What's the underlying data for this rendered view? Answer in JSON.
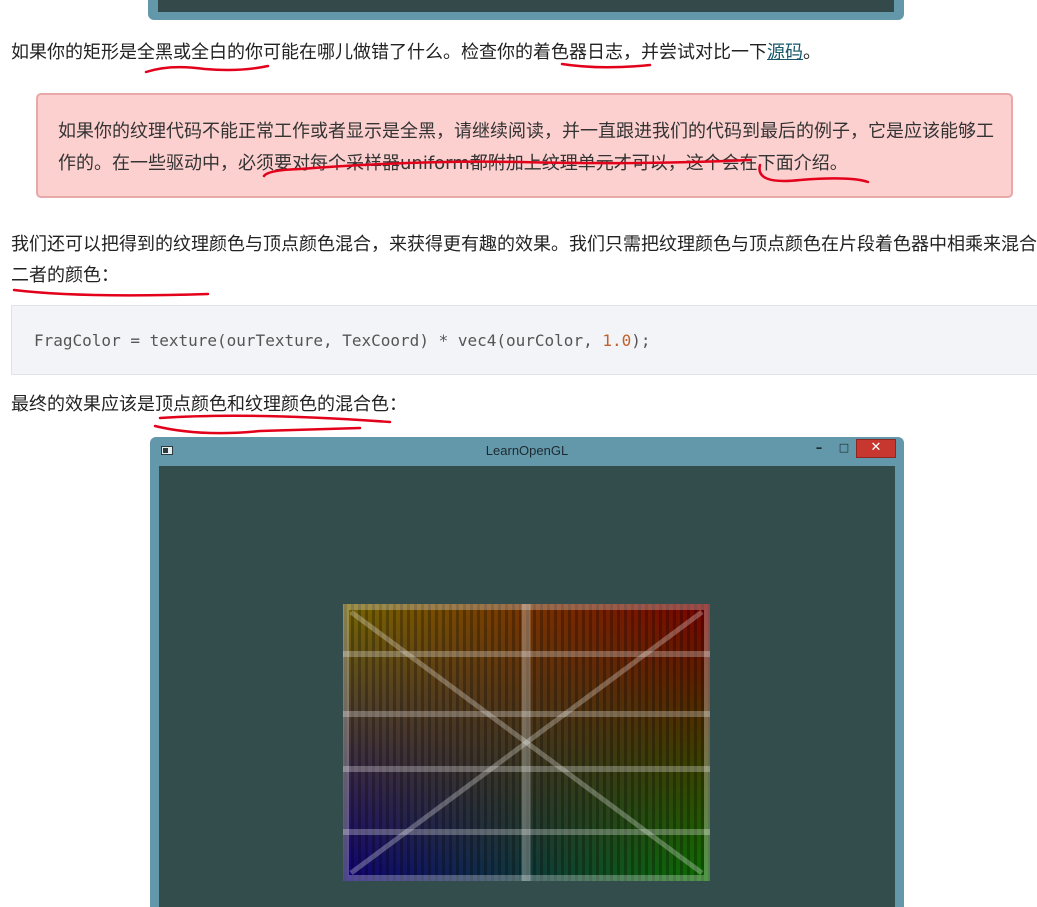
{
  "top_window": {
    "note_visible": true
  },
  "para1": {
    "prefix": "如果你的矩形是",
    "em1": "全黑或全白的",
    "mid1": "你可能在哪儿做错了什么。检查你的",
    "em2": "着色器日志",
    "mid2": "，并尝试对比一下",
    "link": "源码",
    "suffix": "。"
  },
  "warning": {
    "text": "如果你的纹理代码不能正常工作或者显示是全黑，请继续阅读，并一直跟进我们的代码到最后的例子，它是应该能够工作的。在一些驱动中，必须要对每个采样器uniform都附加上纹理单元才可以，这个会在下面介绍。"
  },
  "para2": {
    "text": "我们还可以把得到的纹理颜色与顶点颜色混合，来获得更有趣的效果。我们只需把纹理颜色与顶点颜色在片段着色器中相乘来混合二者的颜色："
  },
  "code": {
    "before": "FragColor = texture(ourTexture, TexCoord) * vec4(ourColor, ",
    "number": "1.0",
    "after": ");"
  },
  "para3": {
    "text": "最终的效果应该是顶点颜色和纹理颜色的混合色："
  },
  "window": {
    "title": "LearnOpenGL",
    "min_glyph": "–",
    "max_glyph": "□",
    "close_glyph": "✕"
  },
  "colors": {
    "window_frame": "#6397aa",
    "client_bg": "#334d4d",
    "warning_bg": "#fdd0d0",
    "annotation": "#e3001b",
    "corner_top_left": "#ffff00",
    "corner_top_right": "#ff0000",
    "corner_bottom_left": "#0000ff",
    "corner_bottom_right": "#00ff00"
  }
}
